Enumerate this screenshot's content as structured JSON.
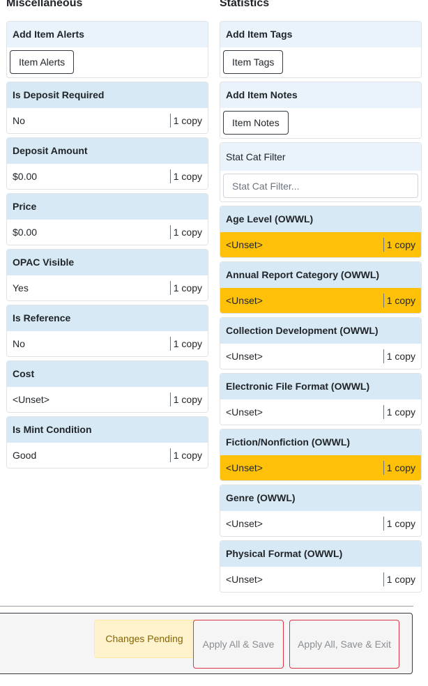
{
  "left": {
    "title": "Miscellaneous",
    "alerts": {
      "header": "Add Item Alerts",
      "button": "Item Alerts"
    },
    "fields": [
      {
        "label": "Is Deposit Required",
        "value": "No",
        "copies": "1 copy"
      },
      {
        "label": "Deposit Amount",
        "value": "$0.00",
        "copies": "1 copy"
      },
      {
        "label": "Price",
        "value": "$0.00",
        "copies": "1 copy"
      },
      {
        "label": "OPAC Visible",
        "value": "Yes",
        "copies": "1 copy"
      },
      {
        "label": "Is Reference",
        "value": "No",
        "copies": "1 copy"
      },
      {
        "label": "Cost",
        "value": "<Unset>",
        "copies": "1 copy"
      },
      {
        "label": "Is Mint Condition",
        "value": "Good",
        "copies": "1 copy"
      }
    ]
  },
  "right": {
    "title": "Statistics",
    "tags": {
      "header": "Add Item Tags",
      "button": "Item Tags"
    },
    "notes": {
      "header": "Add Item Notes",
      "button": "Item Notes"
    },
    "filter": {
      "header": "Stat Cat Filter",
      "placeholder": "Stat Cat Filter..."
    },
    "stat_cats": [
      {
        "label": "Age Level (OWWL)",
        "value": "<Unset>",
        "copies": "1 copy",
        "warning": true
      },
      {
        "label": "Annual Report Category (OWWL)",
        "value": "<Unset>",
        "copies": "1 copy",
        "warning": true
      },
      {
        "label": "Collection Development (OWWL)",
        "value": "<Unset>",
        "copies": "1 copy",
        "warning": false
      },
      {
        "label": "Electronic File Format (OWWL)",
        "value": "<Unset>",
        "copies": "1 copy",
        "warning": false
      },
      {
        "label": "Fiction/Nonfiction (OWWL)",
        "value": "<Unset>",
        "copies": "1 copy",
        "warning": true
      },
      {
        "label": "Genre (OWWL)",
        "value": "<Unset>",
        "copies": "1 copy",
        "warning": false
      },
      {
        "label": "Physical Format (OWWL)",
        "value": "<Unset>",
        "copies": "1 copy",
        "warning": false
      }
    ]
  },
  "footer": {
    "status": "Changes Pending",
    "apply_save": "Apply All & Save",
    "apply_save_exit": "Apply All, Save & Exit"
  },
  "colors": {
    "card_header": "#d7e9f4",
    "warning": "#ffc107",
    "pending_bg": "#fff3cd",
    "danger_border": "#dc3545"
  }
}
